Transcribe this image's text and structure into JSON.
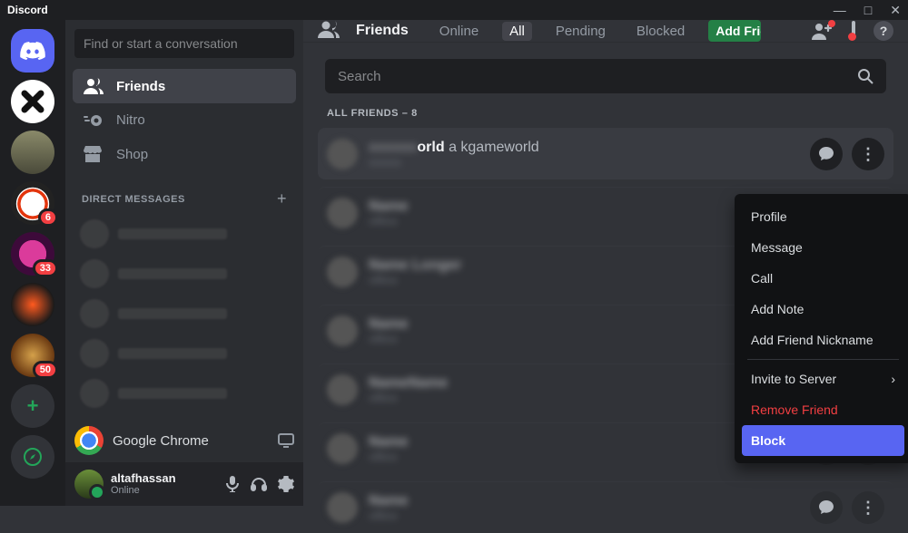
{
  "brand": "Discord",
  "window": {
    "min": "—",
    "max": "□",
    "close": "✕"
  },
  "servers": {
    "badges": {
      "s3": "6",
      "s4": "33",
      "s6": "50"
    }
  },
  "channel_col": {
    "start_convo": "Find or start a conversation",
    "nav": {
      "friends": "Friends",
      "nitro": "Nitro",
      "shop": "Shop"
    },
    "dm_header": "DIRECT MESSAGES",
    "chrome_label": "Google Chrome"
  },
  "user": {
    "name": "altafhassan",
    "status": "Online"
  },
  "topbar": {
    "title": "Friends",
    "tabs": {
      "online": "Online",
      "all": "All",
      "pending": "Pending",
      "blocked": "Blocked"
    },
    "add_friend": "Add Friend",
    "help": "?"
  },
  "search": {
    "placeholder": "Search"
  },
  "section_title": "ALL FRIENDS – 8",
  "friend_visible": {
    "name_part": "orld",
    "sub": "a kgameworld"
  },
  "ctx": {
    "profile": "Profile",
    "message": "Message",
    "call": "Call",
    "add_note": "Add Note",
    "nickname": "Add Friend Nickname",
    "invite": "Invite to Server",
    "remove": "Remove Friend",
    "block": "Block"
  }
}
